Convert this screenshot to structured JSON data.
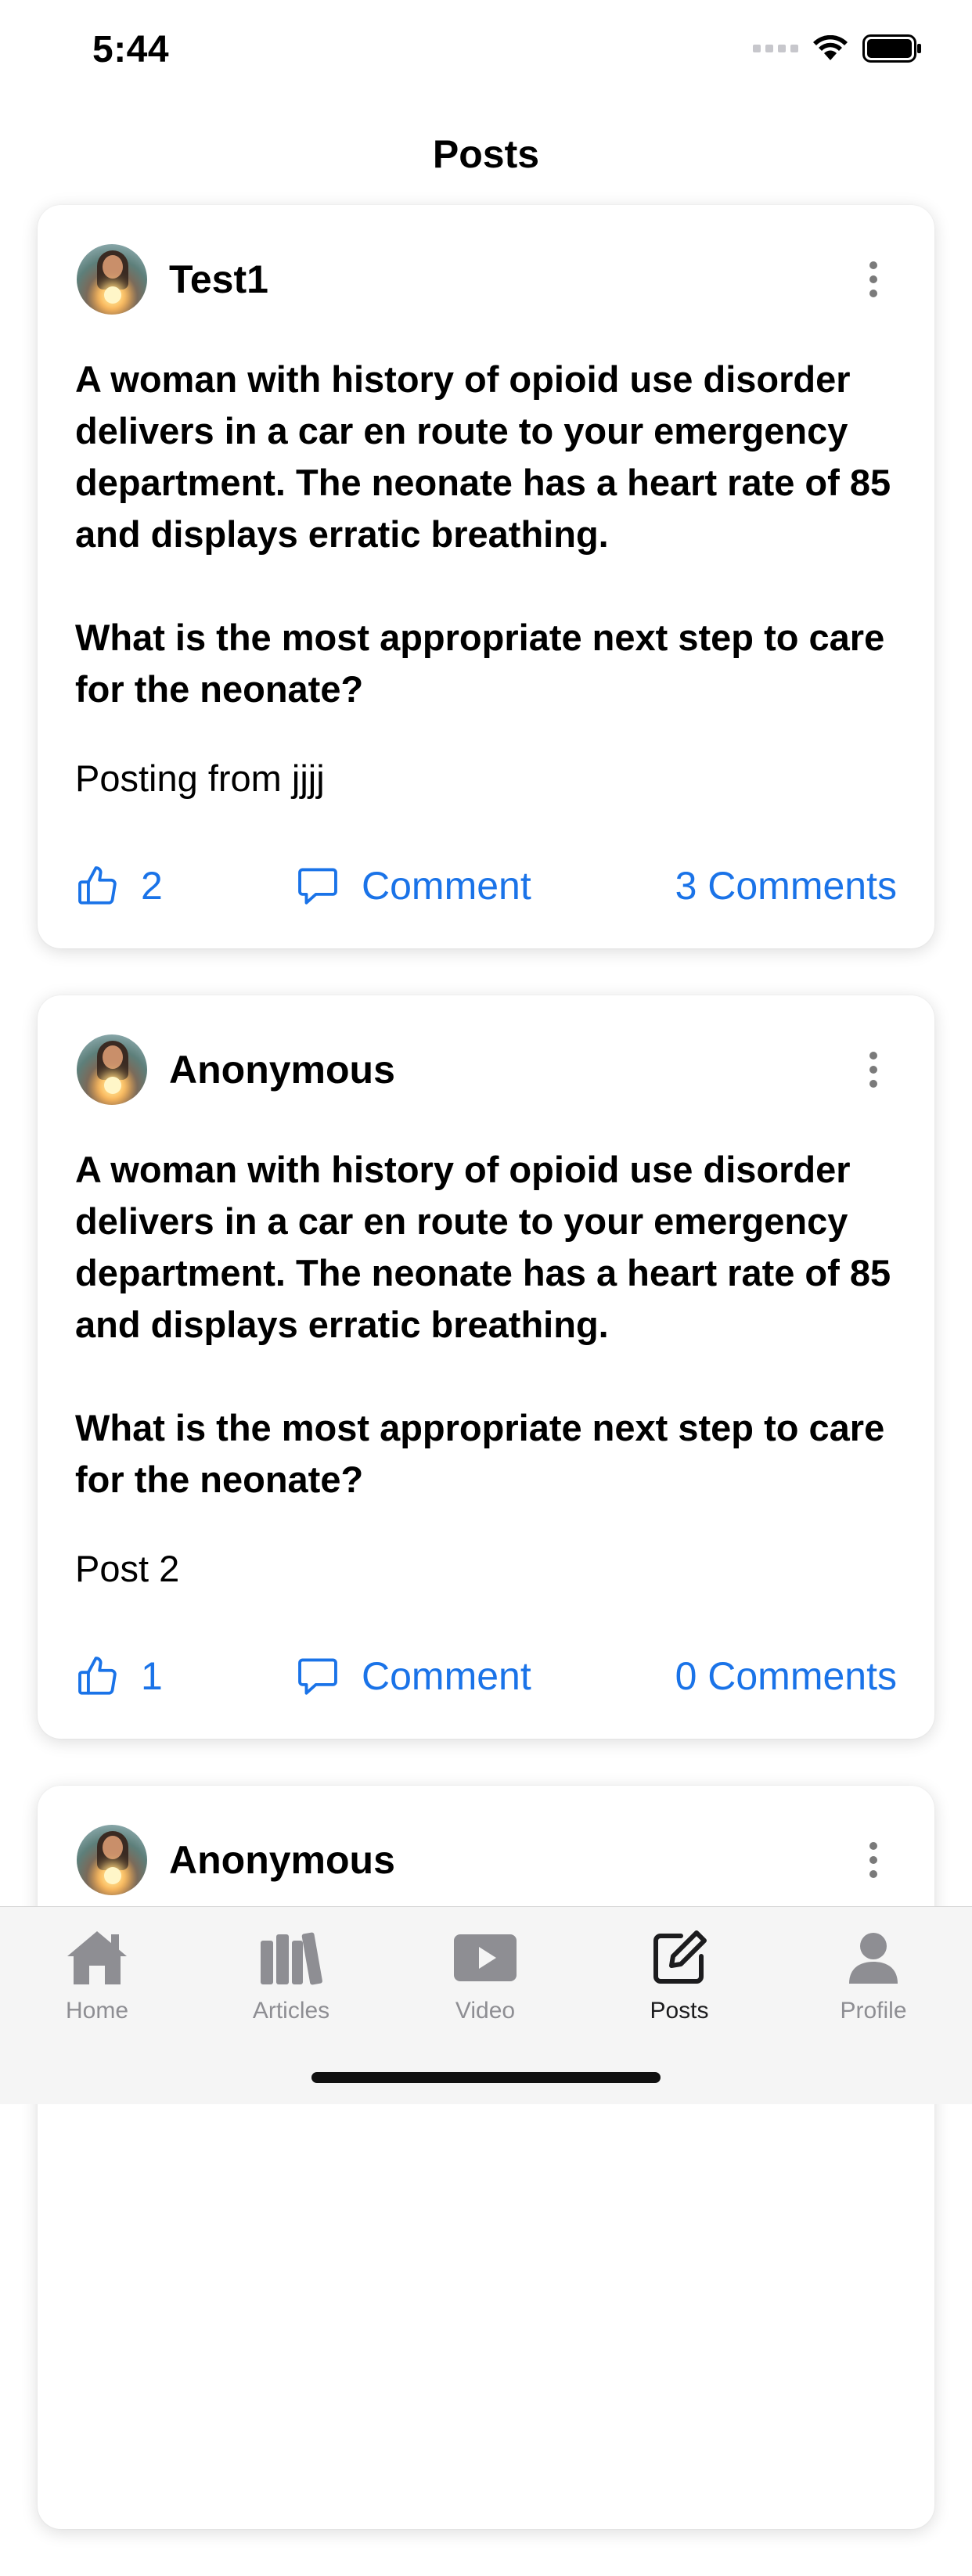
{
  "status_bar": {
    "time": "5:44"
  },
  "nav": {
    "title": "Posts"
  },
  "posts": [
    {
      "author": "Test1",
      "body": "A woman with history of opioid use disorder delivers in a car en route to your emergency department. The neonate has a heart rate of 85 and displays erratic breathing.\n\nWhat is the most appropriate next step to care for the neonate?",
      "caption": "Posting from jjjj",
      "likes": "2",
      "comment_label": "Comment",
      "comments_count": "3 Comments"
    },
    {
      "author": "Anonymous",
      "body": "A woman with history of opioid use disorder delivers in a car en route to your emergency department. The neonate has a heart rate of 85 and displays erratic breathing.\n\nWhat is the most appropriate next step to care for the neonate?",
      "caption": "Post 2",
      "likes": "1",
      "comment_label": "Comment",
      "comments_count": "0 Comments"
    },
    {
      "author": "Anonymous"
    }
  ],
  "tab_bar": {
    "items": [
      {
        "label": "Home",
        "icon": "home-icon"
      },
      {
        "label": "Articles",
        "icon": "books-icon"
      },
      {
        "label": "Video",
        "icon": "play-icon"
      },
      {
        "label": "Posts",
        "icon": "compose-icon"
      },
      {
        "label": "Profile",
        "icon": "person-icon"
      }
    ],
    "active": "Posts"
  },
  "colors": {
    "accent": "#1a73e8",
    "tab_inactive": "#8e8e93",
    "tab_active": "#1c1c1e"
  }
}
